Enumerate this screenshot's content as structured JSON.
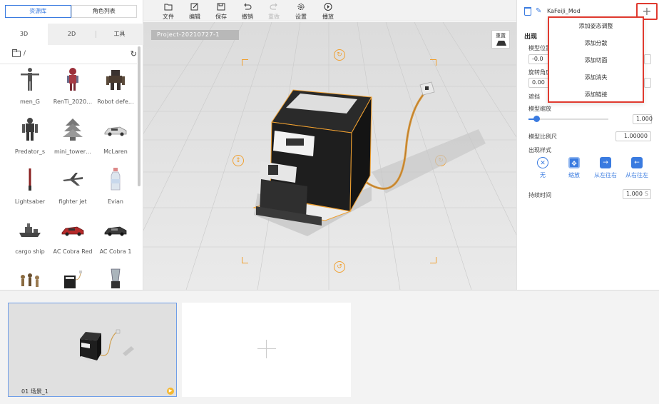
{
  "left_panel": {
    "top_tabs": [
      "资源库",
      "角色列表"
    ],
    "sub_tabs": [
      "3D",
      "2D",
      "工具"
    ],
    "path": "/",
    "models": [
      {
        "label": "men_G",
        "icon": "humanoid-model-icon"
      },
      {
        "label": "RenTi_2020…",
        "icon": "anatomy-model-icon"
      },
      {
        "label": "Robot defe…",
        "icon": "robot-model-icon"
      },
      {
        "label": "Predator_s",
        "icon": "predator-model-icon"
      },
      {
        "label": "mini_tower…",
        "icon": "tower-model-icon"
      },
      {
        "label": "McLaren",
        "icon": "car-model-icon"
      },
      {
        "label": "Lightsaber",
        "icon": "lightsaber-model-icon"
      },
      {
        "label": "fighter jet",
        "icon": "jet-model-icon"
      },
      {
        "label": "Evian",
        "icon": "bottle-model-icon"
      },
      {
        "label": "cargo ship",
        "icon": "ship-model-icon"
      },
      {
        "label": "AC Cobra Red",
        "icon": "car-model-icon"
      },
      {
        "label": "AC Cobra 1",
        "icon": "car-model-icon"
      },
      {
        "label": "",
        "icon": "figurines-model-icon"
      },
      {
        "label": "",
        "icon": "coffee-machine-model-icon"
      },
      {
        "label": "",
        "icon": "blender-model-icon"
      }
    ]
  },
  "toolbar": {
    "file": "文件",
    "edit": "编辑",
    "save": "保存",
    "undo": "撤销",
    "redo": "重做",
    "settings": "设置",
    "play": "播放"
  },
  "viewport": {
    "project_name": "Project-20210727-1",
    "reset_label": "重置"
  },
  "properties": {
    "object_name": "KaFeiJi_Mod",
    "section_appear": "出现",
    "model_position": "模型位置",
    "position_value": "-0.0",
    "rotation": "旋转角度",
    "rotation_value": "0.00",
    "occlusion": "遮挡",
    "model_scale": "模型缩放",
    "scale_value": "1.000",
    "scale_fraction": 0.1,
    "model_ratio": "模型比例尺",
    "ratio_value": "1.00000",
    "appear_style": "出现样式",
    "styles": [
      "无",
      "缩放",
      "从左往右",
      "从右往左"
    ],
    "duration": "持续时间",
    "duration_value": "1.000",
    "duration_unit": "S"
  },
  "dropdown": {
    "items": [
      "添加姿态调整",
      "添加分散",
      "添加切面",
      "添加消失",
      "添加链接"
    ]
  },
  "scenes": {
    "scene1_label": "01  场景_1"
  },
  "colors": {
    "accent": "#3a7be0",
    "highlight": "#e03a2f",
    "gizmo": "#f0a030"
  }
}
